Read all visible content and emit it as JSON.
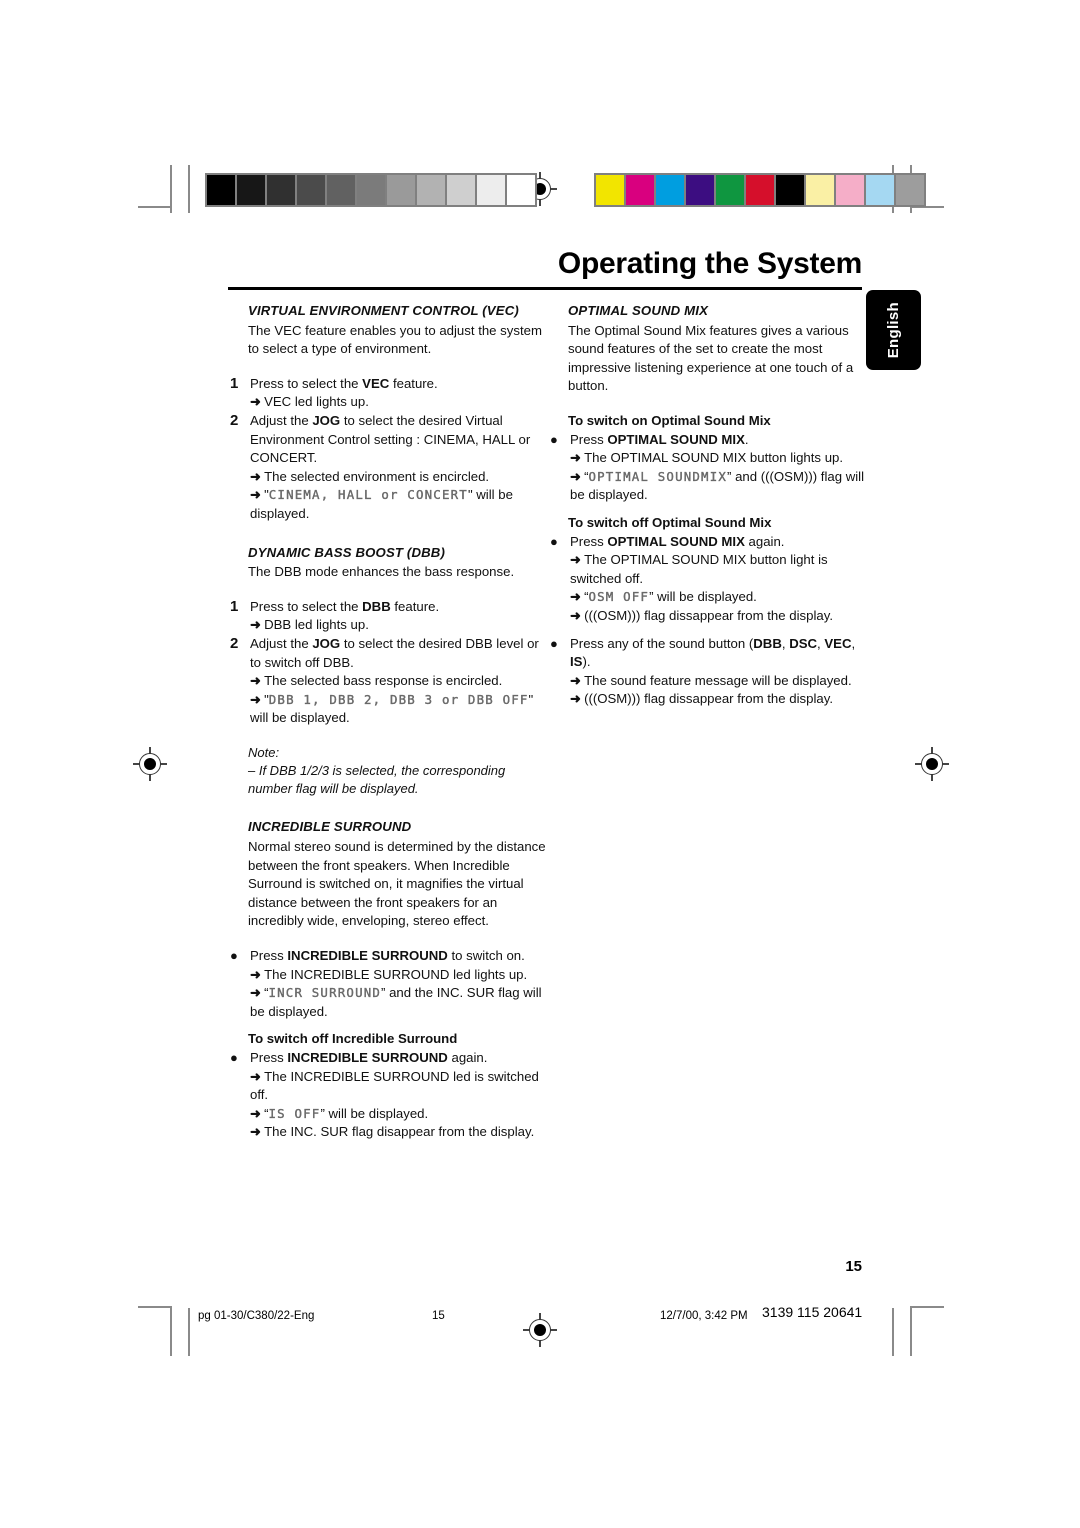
{
  "header": {
    "title": "Operating the System",
    "lang_tab": "English"
  },
  "print_marks": {
    "grayscale_swatches": [
      "#000000",
      "#171717",
      "#303030",
      "#4b4b4b",
      "#616161",
      "#7b7b7b",
      "#9a9a9a",
      "#b2b2b2",
      "#cfcfcf",
      "#ededed",
      "#ffffff"
    ],
    "color_swatches": [
      "#f2e500",
      "#d9007f",
      "#009ee0",
      "#3c0d81",
      "#0f9640",
      "#d50f2b",
      "#000000",
      "#faf0a5",
      "#f5aec8",
      "#a5d8f2",
      "#9d9d9d"
    ],
    "registration_icon": "registration-target-icon"
  },
  "left_column": {
    "vec": {
      "heading": "VIRTUAL ENVIRONMENT CONTROL (VEC)",
      "intro": "The VEC feature enables you to adjust the system to select a type of environment.",
      "steps": [
        {
          "num": "1",
          "text_pre": "Press to select the ",
          "bold": "VEC",
          "text_post": " feature.",
          "results": [
            "VEC led lights up."
          ]
        },
        {
          "num": "2",
          "text_pre": "Adjust the ",
          "bold": "JOG",
          "text_post": " to select the desired Virtual Environment Control setting : CINEMA, HALL or CONCERT.",
          "results": [
            "The selected environment is encircled."
          ],
          "lcd_result_prefix": "\"",
          "lcd_result": "CINEMA, HALL or CONCERT",
          "lcd_result_suffix": "\" will be displayed."
        }
      ]
    },
    "dbb": {
      "heading": "DYNAMIC BASS BOOST (DBB)",
      "intro": "The DBB mode enhances the bass response.",
      "steps": [
        {
          "num": "1",
          "text_pre": "Press to select the ",
          "bold": "DBB",
          "text_post": " feature.",
          "results": [
            "DBB led lights up."
          ]
        },
        {
          "num": "2",
          "text_pre": "Adjust the ",
          "bold": "JOG",
          "text_post": " to select the desired DBB level or to switch off DBB.",
          "results": [
            "The selected bass response is encircled."
          ],
          "lcd_result_prefix": "\"",
          "lcd_result": "DBB 1, DBB 2, DBB 3 or DBB OFF",
          "lcd_result_suffix": "\" will be displayed."
        }
      ],
      "note_label": "Note:",
      "note_text": "–  If DBB 1/2/3 is selected, the corresponding number flag will be displayed."
    },
    "incredible_surround": {
      "heading": "INCREDIBLE SURROUND",
      "intro": "Normal stereo sound is determined by the distance between the front speakers. When Incredible Surround is switched on, it magnifies the virtual distance between the front speakers for an incredibly wide, enveloping,  stereo effect.",
      "on_bullet_pre": "Press ",
      "on_bullet_bold": "INCREDIBLE SURROUND",
      "on_bullet_post": " to switch on.",
      "on_results": [
        "The INCREDIBLE SURROUND led lights up."
      ],
      "on_lcd_prefix": "“",
      "on_lcd": "INCR SURROUND",
      "on_lcd_suffix": "” and the INC. SUR flag will be displayed.",
      "off_heading": "To switch off Incredible Surround",
      "off_bullet_pre": "Press ",
      "off_bullet_bold": "INCREDIBLE SURROUND",
      "off_bullet_post": " again.",
      "off_results": [
        "The INCREDIBLE SURROUND led is switched off."
      ],
      "off_lcd_prefix": "“",
      "off_lcd": "IS OFF",
      "off_lcd_suffix": "”  will be displayed.",
      "off_final": "The INC. SUR flag disappear from the display."
    }
  },
  "right_column": {
    "osm": {
      "heading": "OPTIMAL SOUND MIX",
      "intro": "The Optimal Sound Mix features gives a various sound features of the set to create the most impressive listening experience at one touch of a button.",
      "on_heading": "To switch on Optimal Sound Mix",
      "on_bullet_pre": "Press ",
      "on_bullet_bold": "OPTIMAL SOUND MIX",
      "on_bullet_post": ".",
      "on_results": [
        "The OPTIMAL SOUND MIX button lights up."
      ],
      "on_lcd_prefix": "“",
      "on_lcd": "OPTIMAL SOUNDMIX",
      "on_lcd_suffix": "” and (((OSM))) flag will be displayed.",
      "off_heading": "To switch off Optimal Sound Mix",
      "off_bullet_pre": "Press ",
      "off_bullet_bold": "OPTIMAL SOUND MIX",
      "off_bullet_post": " again.",
      "off_results": [
        "The OPTIMAL SOUND MIX button light is switched off."
      ],
      "off_lcd_prefix": "“",
      "off_lcd": "OSM OFF",
      "off_lcd_suffix": "” will be displayed.",
      "off_final": "(((OSM))) flag dissappear from the display.",
      "any_pre": "Press any of the sound button (",
      "any_bold1": "DBB",
      "any_mid1": ", ",
      "any_bold2": "DSC",
      "any_mid2": ", ",
      "any_bold3": "VEC",
      "any_mid3": ", ",
      "any_bold4": "IS",
      "any_post": ").",
      "any_results": [
        "The sound feature message will be displayed.",
        "(((OSM))) flag dissappear from the display."
      ]
    }
  },
  "footer": {
    "page_number": "15",
    "file_ref": "pg  01-30/C380/22-Eng",
    "footer_page": "15",
    "timestamp": "12/7/00, 3:42 PM",
    "doc_code": "3139 115 20641"
  }
}
